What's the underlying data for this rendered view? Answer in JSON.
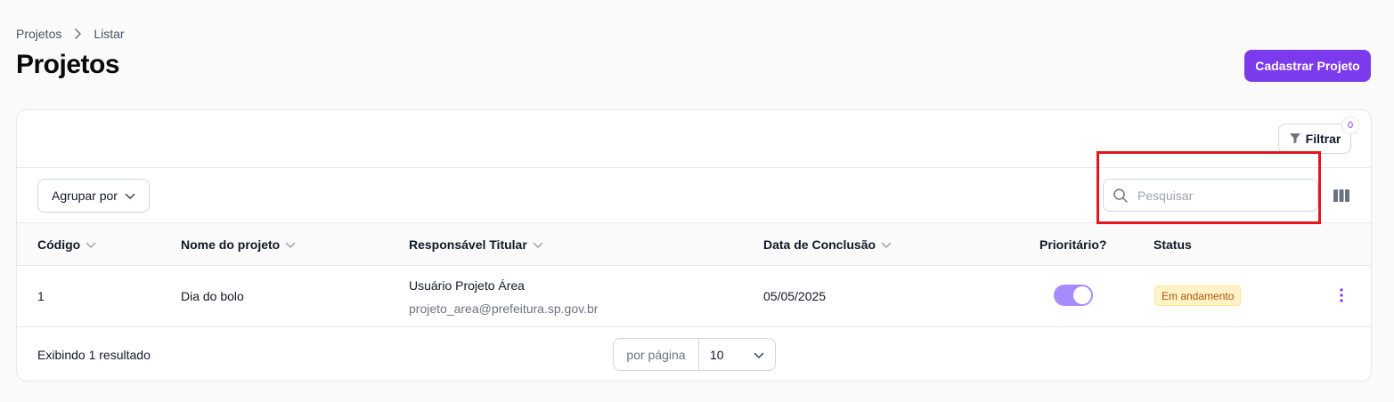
{
  "breadcrumb": {
    "items": [
      "Projetos",
      "Listar"
    ]
  },
  "page": {
    "title": "Projetos",
    "primary_button": "Cadastrar Projeto"
  },
  "filter": {
    "label": "Filtrar",
    "count": "0"
  },
  "toolbar": {
    "group_label": "Agrupar por",
    "search_placeholder": "Pesquisar"
  },
  "table": {
    "columns": [
      "Código",
      "Nome do projeto",
      "Responsável Titular",
      "Data de Conclusão",
      "Prioritário?",
      "Status"
    ],
    "rows": [
      {
        "codigo": "1",
        "nome": "Dia do bolo",
        "responsavel": "Usuário Projeto Área",
        "responsavel_email": "projeto_area@prefeitura.sp.gov.br",
        "data": "05/05/2025",
        "prioritario": true,
        "status": "Em andamento"
      }
    ]
  },
  "footer": {
    "result_text": "Exibindo 1 resultado",
    "per_page_label": "por página",
    "per_page_value": "10"
  },
  "colors": {
    "accent": "#7c3aed",
    "toggle_on": "#a78bfa",
    "status_bg": "#fef3c7",
    "status_text": "#b45309",
    "highlight": "#e5161b"
  },
  "icons": [
    "chevron-right-icon",
    "filter-icon",
    "chevron-down-icon",
    "search-icon",
    "columns-icon",
    "kebab-menu-icon"
  ]
}
